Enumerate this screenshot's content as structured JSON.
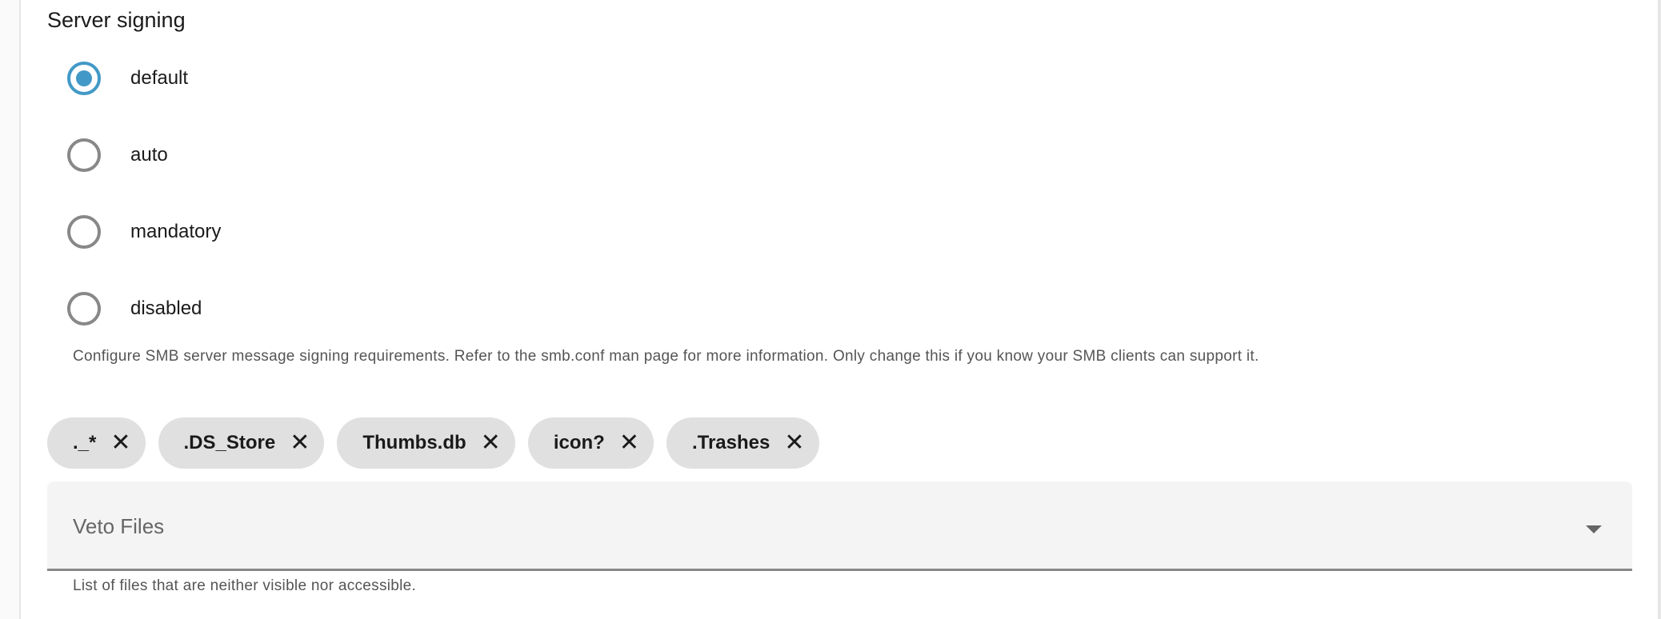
{
  "section_title": "Server signing",
  "radio_options": [
    {
      "label": "default",
      "selected": true
    },
    {
      "label": "auto",
      "selected": false
    },
    {
      "label": "mandatory",
      "selected": false
    },
    {
      "label": "disabled",
      "selected": false
    }
  ],
  "signing_hint": "Configure SMB server message signing requirements. Refer to the smb.conf man page for more information. Only change this if you know your SMB clients can support it.",
  "veto_chips": [
    "._*",
    ".DS_Store",
    "Thumbs.db",
    "icon?",
    ".Trashes"
  ],
  "chip_remove_glyph": "✕",
  "veto_select": {
    "label": "Veto Files",
    "hint": "List of files that are neither visible nor accessible."
  },
  "colors": {
    "accent": "#4299c7"
  }
}
